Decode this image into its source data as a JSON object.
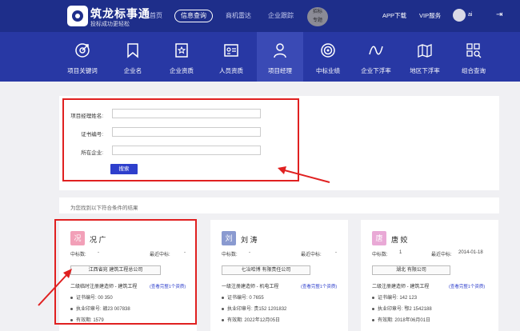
{
  "brand": {
    "name": "筑龙标事通",
    "slogan": "投标成功更轻松"
  },
  "nav": {
    "items": [
      "首页",
      "信息查询",
      "商机雷达",
      "企业跟踪"
    ],
    "active": "信息查询",
    "promo": [
      "招标",
      "专题"
    ],
    "app_download": "APP下载",
    "vip": "VIP服务"
  },
  "categories": [
    {
      "label": "项目关键词",
      "icon": "target-icon"
    },
    {
      "label": "企业名",
      "icon": "bookmark-icon"
    },
    {
      "label": "企业资质",
      "icon": "certificate-star-icon"
    },
    {
      "label": "人员资质",
      "icon": "id-card-icon"
    },
    {
      "label": "项目经理",
      "icon": "person-icon"
    },
    {
      "label": "中标业绩",
      "icon": "concentric-circles-icon"
    },
    {
      "label": "企业下浮率",
      "icon": "wave-icon"
    },
    {
      "label": "地区下浮率",
      "icon": "map-icon"
    },
    {
      "label": "组合查询",
      "icon": "grid-search-icon"
    }
  ],
  "active_category": "项目经理",
  "search_form": {
    "fields": [
      {
        "label": "项目经理姓名:",
        "value": "",
        "placeholder": ""
      },
      {
        "label": "证书编号:",
        "value": "",
        "placeholder": ""
      },
      {
        "label": "所在企业:",
        "value": "",
        "placeholder": ""
      }
    ],
    "search_button": "搜索"
  },
  "result_summary": "为您找到以下符合条件的结果",
  "results": [
    {
      "avatar_char": "况",
      "avatar_color": "#f2a0b8",
      "name": "况   广",
      "win_count_label": "中标数:",
      "win_count": "-",
      "recent_label": "最近中标:",
      "recent": "-",
      "company": "江西省宛     建筑工程总公司",
      "cert": "二级临时注册建造师 - 建筑工程",
      "more_link": "(查看完整1个资质)",
      "cert_no_label": "证书编号:",
      "cert_no": "00     350",
      "seal_no_label": "执业印章号:",
      "seal_no": "赣23    007838",
      "validity_label": "有效期:",
      "validity": "1579       "
    },
    {
      "avatar_char": "刘",
      "avatar_color": "#8a9ad0",
      "name": "刘  涛",
      "win_count_label": "中标数:",
      "win_count": "-",
      "recent_label": "最近中标:",
      "recent": "-",
      "company": "七冶哈博     有限责任公司",
      "cert": "一级注册建造师 - 机电工程",
      "more_link": "(查看完整1个资质)",
      "cert_no_label": "证书编号:",
      "cert_no": "0     7655",
      "seal_no_label": "执业印章号:",
      "seal_no": "贵152     1201832",
      "validity_label": "有效期:",
      "validity": "2022年12月05日"
    },
    {
      "avatar_char": "唐",
      "avatar_color": "#e9a9d6",
      "name": "唐   姣",
      "win_count_label": "中标数:",
      "win_count": "1",
      "recent_label": "最近中标:",
      "recent": "2014-01-18",
      "company": "湖北    有限公司",
      "cert": "二级注册建造师 - 建筑工程",
      "more_link": "(查看完整1个资质)",
      "cert_no_label": "证书编号:",
      "cert_no": "142    123",
      "seal_no_label": "执业印章号:",
      "seal_no": "鄂2     1542188",
      "validity_label": "有效期:",
      "validity": "2018年06月01日"
    }
  ]
}
